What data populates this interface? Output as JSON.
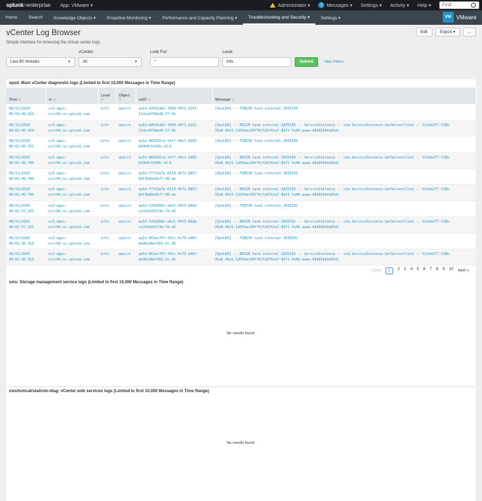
{
  "topbar": {
    "logo_a": "splunk",
    "logo_gt": ">",
    "logo_b": "enterprise",
    "app_menu": "App: VMware ▾",
    "admin": "Administrator ▾",
    "messages_count": "3",
    "messages": "Messages ▾",
    "settings": "Settings ▾",
    "activity": "Activity ▾",
    "help": "Help ▾",
    "find_placeholder": "Find"
  },
  "nav": {
    "items": [
      "Home",
      "Search",
      "Knowledge Objects ▾",
      "Proactive Monitoring ▾",
      "Performance and Capacity Planning ▾",
      "Troubleshooting and Security ▾",
      "Settings ▾"
    ],
    "app_icon": "VM",
    "app_name": "VMware"
  },
  "page": {
    "title": "vCenter Log Browser",
    "subtitle": "Simple interface for browsing the virtual center logs.",
    "edit": "Edit",
    "export": "Export ▾",
    "more": "..."
  },
  "filters": {
    "time_value": "Last 60 minutes",
    "vcenter_label": "vCenter:",
    "vcenter_value": "All",
    "lookfor_label": "Look For:",
    "lookfor_value": "*",
    "level_label": "Level:",
    "level_value": "info",
    "submit": "Submit",
    "hide_filters": "Hide Filters"
  },
  "panel1": {
    "title": "vpxd: Main vCenter diagnostic logs (Limited to first 10,000 Messages in Time Range)",
    "columns": [
      "Time",
      "vc",
      "Level",
      "Object",
      "opID",
      "Message"
    ],
    "rows": [
      [
        "08/13/2020\n00:02:40.924",
        "sv3-apps-\nvctr60.sv.splunk.com",
        "info",
        "vpxLro",
        "opId-e05d1a61-f958-49f1-b191-\n17dce479bbd9-27-4b",
        "[VpxLRO] -- FINISH task-internal-2035295"
      ],
      [
        "08/13/2020\n00:02:40.924",
        "sv3-apps-\nvctr60.sv.splunk.com",
        "info",
        "vpxLro",
        "opId-e05d1a61-f958-49f1-b191-\n17dce479bbd9-27-4b",
        "[VpxLRO] -- BEGIN task-internal-2035295 -- ServiceInstance -- vim.ServiceInstance.GetServerClock -- 52c0a277-f28b-\n35a6-4021-12034ac58f70(5207b1a7-8d72-fe46-aaae-d64d56d4a65d)"
      ],
      [
        "08/13/2020\n00:02:40.701",
        "sv3-apps-\nvctr60.sv.splunk.com",
        "info",
        "vpxLro",
        "opId-d682d1ca-7eff-44c1-b985-\nb59b0c5939b-c9-6",
        "[VpxLRO] -- FINISH task-internal-2035294"
      ],
      [
        "08/13/2020\n00:02:40.700",
        "sv3-apps-\nvctr60.sv.splunk.com",
        "info",
        "vpxLro",
        "opId-d682d1ca-7eff-44c1-b985-\nb59b0c5939b-c9-6",
        "[VpxLRO] -- BEGIN task-internal-2035294 -- ServiceInstance -- vim.ServiceInstance.GetServerClock -- 52c0a277-f28b-\n35a6-4021-12034ac58f70(5207b1a7-8d72-fe46-aaae-d64d56d4a65d)"
      ],
      [
        "08/13/2020\n00:02:40.700",
        "sv3-apps-\nvctr60.sv.splunk.com",
        "info",
        "vpxLro",
        "opId-f7153e7e-0118-4b72-8857-\n9df3b80a5b77-00-ee",
        "[VpxLRO] -- FINISH task-internal-2035293"
      ],
      [
        "08/13/2020\n00:02:40.700",
        "sv3-apps-\nvctr60.sv.splunk.com",
        "info",
        "vpxLro",
        "opId-f7153e7e-0118-4b72-8857-\n9df3b80a5b77-00-ee",
        "[VpxLRO] -- BEGIN task-internal-2035293 -- ServiceInstance -- vim.ServiceInstance.GetServerClock -- 52c0a277-f28b-\n35a6-4021-12034ac58f70(5207b1a7-8d72-fe46-aaae-d64d56d4a65d)"
      ],
      [
        "08/13/2020\n00:02:37.225",
        "sv3-apps-\nvctr60.sv.splunk.com",
        "info",
        "vpxLro",
        "opId-7262858c-a621-4013-8ddb-\nccd319dfb73e-7d-d3",
        "[VpxLRO] -- FINISH task-internal-2035292"
      ],
      [
        "08/13/2020\n00:02:37.225",
        "sv3-apps-\nvctr60.sv.splunk.com",
        "info",
        "vpxLro",
        "opId-7262858c-a621-4013-8ddb-\nccd319dfb73e-7d-d3",
        "[VpxLRO] -- BEGIN task-internal-2035292 -- ServiceInstance -- vim.ServiceInstance.GetServerClock -- 52c0a277-f28b-\n35a6-4021-12034ac58f70(5207b1a7-8d72-fe46-aaae-d64d56d4a65d)"
      ],
      [
        "08/13/2020\n00:02:36.519",
        "sv3-apps-\nvctr60.sv.splunk.com",
        "info",
        "vpxLro",
        "opId-062ac70f-341c-4c70-a90f-\nde98c98ef3b5-2c-36",
        "[VpxLRO] -- FINISH task-internal-2035291"
      ],
      [
        "08/13/2020\n00:02:36.519",
        "sv3-apps-\nvctr60.sv.splunk.com",
        "info",
        "vpxLro",
        "opId-062ac70f-341c-4c70-a90f-\nde98c98ef3b5-2c-36",
        "[VpxLRO] -- BEGIN task-internal-2035291 -- ServiceInstance -- vim.ServiceInstance.GetServerClock -- 52c0a277-f28b-\n35a6-4021-12034ac58f70(5207b1a7-8d72-fe46-aaae-d64d56d4a65d)"
      ]
    ],
    "pager": {
      "prev": "« prev",
      "pages": [
        "1",
        "2",
        "3",
        "4",
        "5",
        "6",
        "7",
        "8",
        "9",
        "10"
      ],
      "current": "1",
      "next": "next »"
    }
  },
  "panel2": {
    "title": "sms: Storage management service logs (Limited to first 10,000 Messages in Time Range)",
    "empty": "No results found."
  },
  "panel3": {
    "title": "vws/tomcat/stat/cim-diag: vCenter web services logs (Limited to first 10,000 Messages in Time Range)",
    "empty": "No results found."
  },
  "colors": {
    "topbar": "#1a1c21",
    "appnav": "#3c444d",
    "accent_green": "#5cc05c",
    "link_blue": "#1e93c6"
  }
}
